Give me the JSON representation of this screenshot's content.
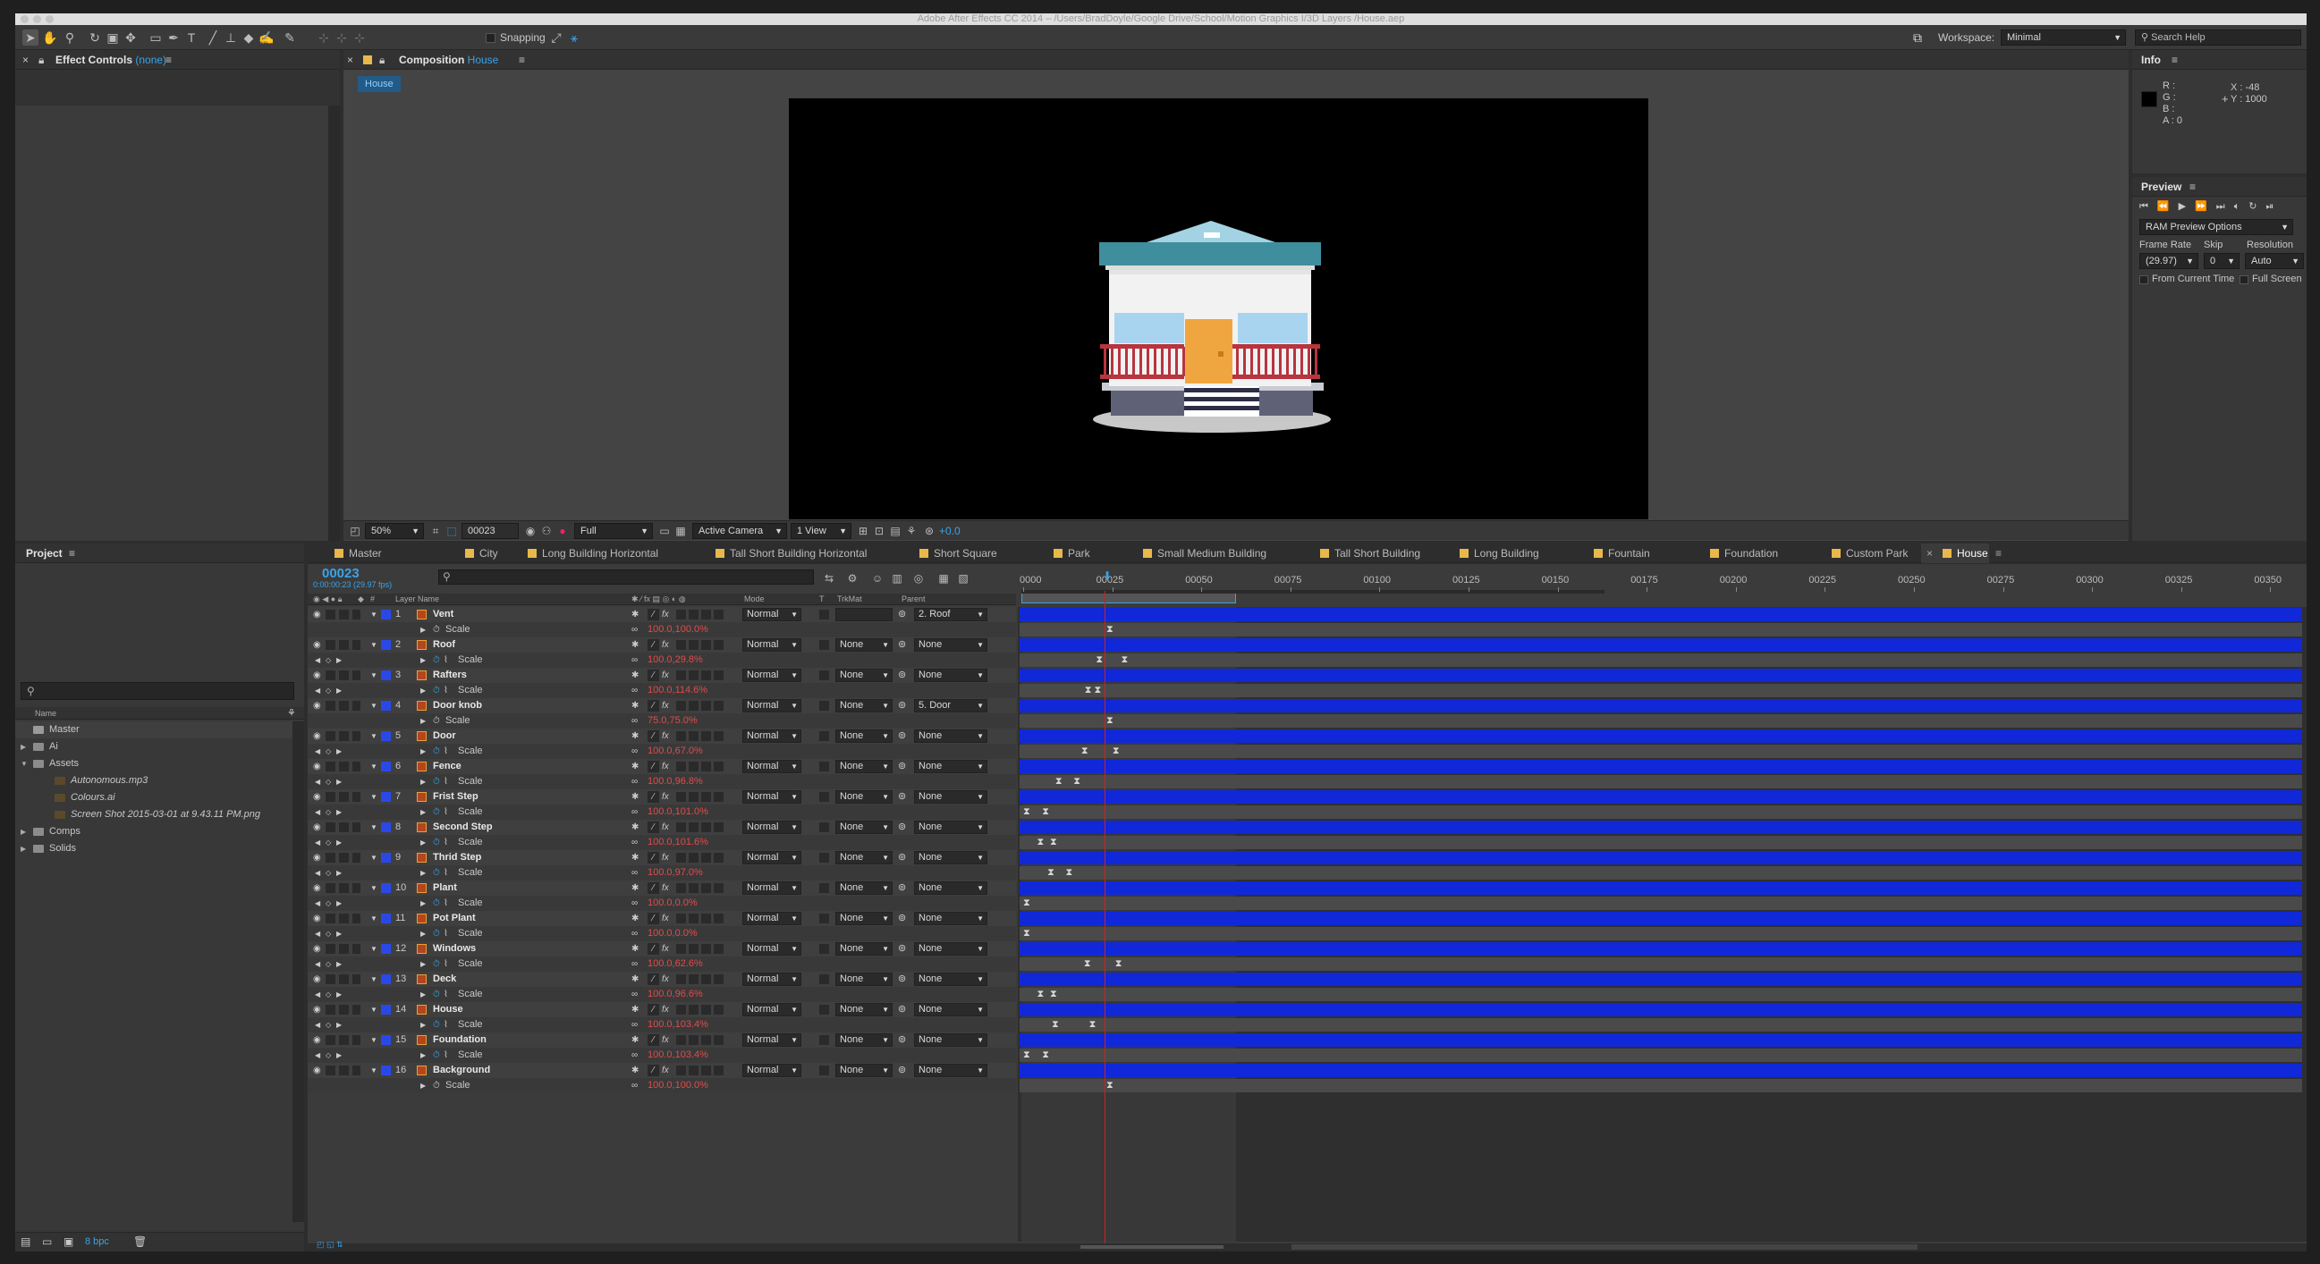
{
  "title": "Adobe After Effects CC 2014 – /Users/BradDoyle/Google Drive/School/Motion Graphics I/3D Layers /House.aep",
  "toolbar": {
    "snapping": "Snapping",
    "workspace_label": "Workspace:",
    "workspace": "Minimal",
    "search": "Search Help"
  },
  "effect_controls": {
    "title": "Effect Controls",
    "subject": "(none)"
  },
  "composition": {
    "title": "Composition",
    "name": "House",
    "crumb": "House"
  },
  "viewer_bar": {
    "zoom": "50%",
    "timecode": "00023",
    "resolution": "Full",
    "camera": "Active Camera",
    "views": "1 View",
    "exposure": "+0.0"
  },
  "info": {
    "title": "Info",
    "r": "R :",
    "g": "G :",
    "b": "B :",
    "a": "A : 0",
    "x": "X : -48",
    "y": "Y : 1000"
  },
  "preview": {
    "title": "Preview",
    "ram": "RAM Preview Options",
    "frame_rate_label": "Frame Rate",
    "skip_label": "Skip",
    "resolution_label": "Resolution",
    "frame_rate": "(29.97)",
    "skip": "0",
    "resolution": "Auto",
    "from_current": "From Current Time",
    "full_screen": "Full Screen"
  },
  "project": {
    "title": "Project",
    "name_col": "Name",
    "items": [
      {
        "name": "Master",
        "indent": 0,
        "tw": ""
      },
      {
        "name": "Ai",
        "indent": 0,
        "tw": "▶"
      },
      {
        "name": "Assets",
        "indent": 0,
        "tw": "▼"
      },
      {
        "name": "Autonomous.mp3",
        "indent": 1,
        "tw": ""
      },
      {
        "name": "Colours.ai",
        "indent": 1,
        "tw": ""
      },
      {
        "name": "Screen Shot 2015-03-01 at 9.43.11 PM.png",
        "indent": 1,
        "tw": ""
      },
      {
        "name": "Comps",
        "indent": 0,
        "tw": "▶"
      },
      {
        "name": "Solids",
        "indent": 0,
        "tw": "▶"
      }
    ],
    "bpc": "8 bpc"
  },
  "timeline_tabs": [
    "Master",
    "City",
    "Long Building Horizontal",
    "Tall Short Building Horizontal",
    "Short Square",
    "Park",
    "Small Medium Building",
    "Tall Short Building",
    "Long Building",
    "Fountain",
    "Foundation",
    "Custom Park",
    "House"
  ],
  "timeline": {
    "timecode": "00023",
    "timecode_sub": "0:00:00:23 (29.97 fps)",
    "headers": {
      "num": "#",
      "layer_name": "Layer Name",
      "mode": "Mode",
      "t": "T",
      "trkmat": "TrkMat",
      "parent": "Parent"
    },
    "ruler": [
      "0000",
      "00025",
      "00050",
      "00075",
      "00100",
      "00125",
      "00150",
      "00175",
      "00200",
      "00225",
      "00250",
      "00275",
      "00300",
      "00325",
      "00350"
    ],
    "layers": [
      {
        "n": "1",
        "name": "Vent",
        "mode": "Normal",
        "trkmat": "",
        "parent": "2. Roof",
        "scale": "100.0,100.0%",
        "linked": true,
        "keys": [
          0.98
        ]
      },
      {
        "n": "2",
        "name": "Roof",
        "mode": "Normal",
        "trkmat": "None",
        "parent": "None",
        "scale": "100.0,29.8%",
        "linked": false,
        "keys": [
          0.86,
          1.15
        ]
      },
      {
        "n": "3",
        "name": "Rafters",
        "mode": "Normal",
        "trkmat": "None",
        "parent": "None",
        "scale": "100.0,114.6%",
        "linked": false,
        "keys": [
          0.73,
          0.84
        ]
      },
      {
        "n": "4",
        "name": "Door knob",
        "mode": "Normal",
        "trkmat": "None",
        "parent": "5. Door",
        "scale": "75.0,75.0%",
        "linked": true,
        "keys": [
          0.98
        ]
      },
      {
        "n": "5",
        "name": "Door",
        "mode": "Normal",
        "trkmat": "None",
        "parent": "None",
        "scale": "100.0,67.0%",
        "linked": false,
        "keys": [
          0.69,
          1.05
        ]
      },
      {
        "n": "6",
        "name": "Fence",
        "mode": "Normal",
        "trkmat": "None",
        "parent": "None",
        "scale": "100.0,96.8%",
        "linked": false,
        "keys": [
          0.39,
          0.6
        ]
      },
      {
        "n": "7",
        "name": "Frist Step",
        "mode": "Normal",
        "trkmat": "None",
        "parent": "None",
        "scale": "100.0,101.0%",
        "linked": false,
        "keys": [
          0.02,
          0.24
        ]
      },
      {
        "n": "8",
        "name": "Second Step",
        "mode": "Normal",
        "trkmat": "None",
        "parent": "None",
        "scale": "100.0,101.6%",
        "linked": false,
        "keys": [
          0.18,
          0.33
        ]
      },
      {
        "n": "9",
        "name": "Thrid Step",
        "mode": "Normal",
        "trkmat": "None",
        "parent": "None",
        "scale": "100.0,97.0%",
        "linked": false,
        "keys": [
          0.3,
          0.51
        ]
      },
      {
        "n": "10",
        "name": "Plant",
        "mode": "Normal",
        "trkmat": "None",
        "parent": "None",
        "scale": "100.0,0.0%",
        "linked": false,
        "keys": [
          0.02
        ]
      },
      {
        "n": "11",
        "name": "Pot Plant",
        "mode": "Normal",
        "trkmat": "None",
        "parent": "None",
        "scale": "100.0,0.0%",
        "linked": false,
        "keys": [
          0.02
        ]
      },
      {
        "n": "12",
        "name": "Windows",
        "mode": "Normal",
        "trkmat": "None",
        "parent": "None",
        "scale": "100.0,62.6%",
        "linked": false,
        "keys": [
          0.72,
          1.08
        ]
      },
      {
        "n": "13",
        "name": "Deck",
        "mode": "Normal",
        "trkmat": "None",
        "parent": "None",
        "scale": "100.0,96.6%",
        "linked": false,
        "keys": [
          0.18,
          0.33
        ]
      },
      {
        "n": "14",
        "name": "House",
        "mode": "Normal",
        "trkmat": "None",
        "parent": "None",
        "scale": "100.0,103.4%",
        "linked": false,
        "keys": [
          0.35,
          0.78
        ]
      },
      {
        "n": "15",
        "name": "Foundation",
        "mode": "Normal",
        "trkmat": "None",
        "parent": "None",
        "scale": "100.0,103.4%",
        "linked": false,
        "keys": [
          0.02,
          0.24
        ]
      },
      {
        "n": "16",
        "name": "Background",
        "mode": "Normal",
        "trkmat": "None",
        "parent": "None",
        "scale": "100.0,100.0%",
        "linked": true,
        "keys": [
          0.98
        ]
      }
    ],
    "prop_label": "Scale"
  },
  "colors": {
    "accent": "#3aa3e8",
    "layer_bar": "#1028d8",
    "playhead": "#d02020",
    "label": "#2a48e8",
    "value_red": "#e04b4b"
  }
}
